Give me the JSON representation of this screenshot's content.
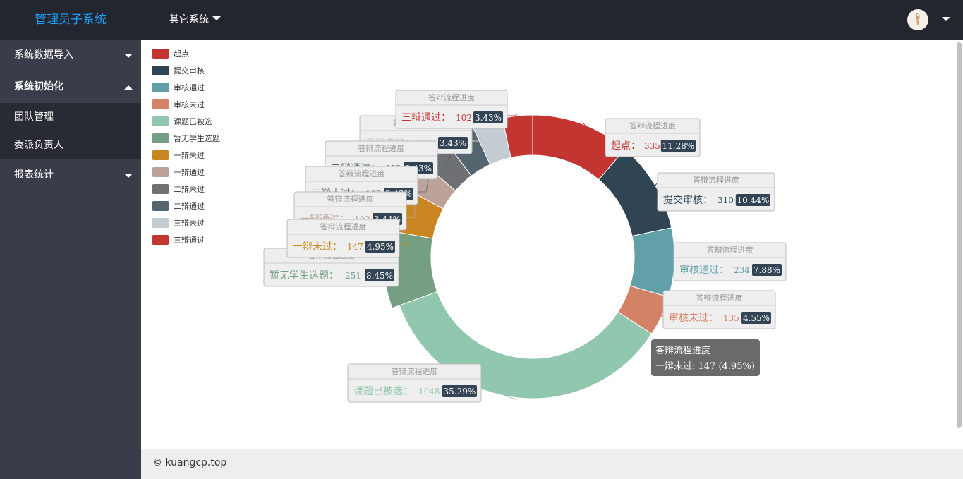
{
  "header": {
    "brand": "管理员子系统",
    "nav_label": "其它系统"
  },
  "sidebar": {
    "items": [
      {
        "label": "系统数据导入"
      },
      {
        "label": "系统初始化"
      },
      {
        "label": "报表统计"
      }
    ],
    "sub_items": [
      {
        "label": "团队管理"
      },
      {
        "label": "委派负责人"
      }
    ]
  },
  "footer": {
    "copyright": "© kuangcp.top"
  },
  "chart_data": {
    "type": "pie",
    "series_name": "答辩流程进度",
    "slices": [
      {
        "name": "起点",
        "value": 335,
        "percent": "11.28%",
        "color": "#c23531"
      },
      {
        "name": "提交审核",
        "value": 310,
        "percent": "10.44%",
        "color": "#2f4554"
      },
      {
        "name": "审核通过",
        "value": 234,
        "percent": "7.88%",
        "color": "#61a0a8"
      },
      {
        "name": "审核未过",
        "value": 135,
        "percent": "4.55%",
        "color": "#d48265"
      },
      {
        "name": "课题已被选",
        "value": 1048,
        "percent": "35.29%",
        "color": "#91c7ae"
      },
      {
        "name": "暂无学生选题",
        "value": 251,
        "percent": "8.45%",
        "color": "#749f83"
      },
      {
        "name": "一辩未过",
        "value": 147,
        "percent": "4.95%",
        "color": "#ca8622"
      },
      {
        "name": "一辩通过",
        "value": 102,
        "percent": "3.44%",
        "color": "#bda29a"
      },
      {
        "name": "二辩未过",
        "value": 102,
        "percent": "3.43%",
        "color": "#6e7074"
      },
      {
        "name": "二辩通过",
        "value": 102,
        "percent": "3.43%",
        "color": "#546570"
      },
      {
        "name": "三辩未过",
        "value": 102,
        "percent": "3.43%",
        "color": "#c4ccd3"
      },
      {
        "name": "三辩通过",
        "value": 102,
        "percent": "3.43%",
        "color": "#c23531"
      }
    ],
    "legend_position": "top-left",
    "tooltip": {
      "title": "答辩流程进度",
      "text": "一辩未过: 147 (4.95%)"
    }
  }
}
